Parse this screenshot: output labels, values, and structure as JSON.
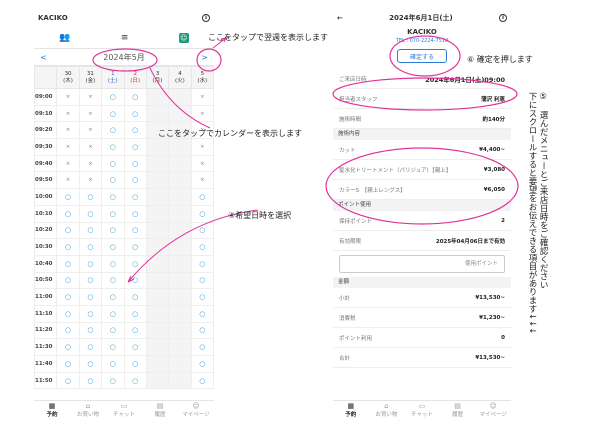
{
  "left": {
    "app_title": "KACIKO",
    "prev_arrow": "<",
    "next_arrow": ">",
    "month": "2024年5月",
    "day_headers": [
      {
        "date": "30",
        "dow": "(木)"
      },
      {
        "date": "31",
        "dow": "(金)"
      },
      {
        "date": "1",
        "dow": "(土)"
      },
      {
        "date": "2",
        "dow": "(日)"
      },
      {
        "date": "3",
        "dow": "(月)"
      },
      {
        "date": "4",
        "dow": "(火)"
      },
      {
        "date": "5",
        "dow": "(水)"
      }
    ],
    "times": [
      "09:00",
      "09:10",
      "09:20",
      "09:30",
      "09:40",
      "09:50",
      "10:00",
      "10:10",
      "10:20",
      "10:30",
      "10:40",
      "10:50",
      "11:00",
      "11:10",
      "11:20",
      "11:30",
      "11:40",
      "11:50"
    ],
    "slots": [
      [
        "x",
        "x",
        "o",
        "o",
        "",
        "",
        "x"
      ],
      [
        "x",
        "x",
        "o",
        "o",
        "",
        "",
        "x"
      ],
      [
        "x",
        "x",
        "o",
        "o",
        "",
        "",
        "x"
      ],
      [
        "x",
        "x",
        "o",
        "o",
        "",
        "",
        "x"
      ],
      [
        "x",
        "x",
        "o",
        "o",
        "",
        "",
        "x"
      ],
      [
        "x",
        "x",
        "o",
        "o",
        "",
        "",
        "x"
      ],
      [
        "o",
        "o",
        "o",
        "o",
        "",
        "",
        "o"
      ],
      [
        "o",
        "o",
        "o",
        "o",
        "",
        "",
        "o"
      ],
      [
        "o",
        "o",
        "o",
        "o",
        "",
        "",
        "o"
      ],
      [
        "o",
        "o",
        "o",
        "o",
        "",
        "",
        "o"
      ],
      [
        "o",
        "o",
        "o",
        "o",
        "",
        "",
        "o"
      ],
      [
        "o",
        "o",
        "o",
        "o",
        "",
        "",
        "o"
      ],
      [
        "o",
        "o",
        "o",
        "o",
        "",
        "",
        "o"
      ],
      [
        "o",
        "o",
        "o",
        "o",
        "",
        "",
        "o"
      ],
      [
        "o",
        "o",
        "o",
        "o",
        "",
        "",
        "o"
      ],
      [
        "o",
        "o",
        "o",
        "o",
        "",
        "",
        "o"
      ],
      [
        "o",
        "o",
        "o",
        "o",
        "",
        "",
        "o"
      ],
      [
        "o",
        "o",
        "o",
        "o",
        "",
        "",
        "o"
      ]
    ],
    "nav": [
      {
        "label": "予約",
        "icon": "▦"
      },
      {
        "label": "お買い物",
        "icon": "⌂"
      },
      {
        "label": "チャット",
        "icon": "▭"
      },
      {
        "label": "履歴",
        "icon": "▤"
      },
      {
        "label": "マイページ",
        "icon": "☺"
      }
    ]
  },
  "right": {
    "header_date": "2024年6月1日(土)",
    "salon_name": "KACIKO",
    "tel": "TEL : 070-2224-7510",
    "confirm_label": "確定する",
    "visit_label": "ご来店日時",
    "visit_value": "2024年6月1日(土)09:00",
    "staff_label": "担当者スタッフ",
    "staff_value": "蒲沢 利恵",
    "duration_label": "施術時間",
    "duration_value": "約140分",
    "menu_section": "施術内容",
    "menu_items": [
      {
        "name": "カット",
        "price": "¥4,400~"
      },
      {
        "name": "髪水化トリートメント（パリジュア）【親上】",
        "price": "¥3,080"
      },
      {
        "name": "カラーS　【親上レングス】",
        "price": "¥6,050"
      }
    ],
    "points_section": "ポイント使用",
    "held_points_label": "保持ポイント",
    "held_points_value": "2",
    "expiry_label": "有効期限",
    "expiry_value": "2025年04月06日まで有効",
    "points_placeholder": "使用ポイント",
    "amount_section": "金額",
    "subtotal_label": "小計",
    "subtotal_value": "¥13,530~",
    "tax_label": "消費税",
    "tax_value": "¥1,230~",
    "points_use_label": "ポイント利用",
    "points_use_value": "0",
    "total_label": "合計",
    "total_value": "¥13,530~"
  },
  "annotations": {
    "tap_week": "ここをタップで翌週を表示します",
    "tap_calendar": "ここをタップでカレンダーを表示します",
    "select_time": "④希望日時を選択",
    "press_confirm": "⑥ 確定を押します",
    "vertical_text": "⑤　選んだメニューとご来店日時をご確認ください\n下にスクロールすると要望をお伝えできる項目があります↓↓↓"
  },
  "colors": {
    "accent_pink": "#e0339a",
    "link_blue": "#2a7ed8",
    "slot_blue": "#2a9bd3"
  }
}
